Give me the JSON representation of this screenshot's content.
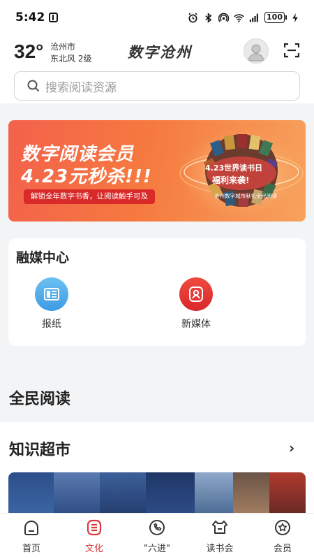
{
  "status_bar": {
    "time": "5:42",
    "battery": "100"
  },
  "header": {
    "temperature": "32°",
    "city": "沧州市",
    "wind": "东北风  2级",
    "app_title": "数字沧州",
    "search_placeholder": "搜索阅读资源"
  },
  "banner": {
    "title_line1": "数字阅读会员",
    "title_line2": "4.23元秒杀!!!",
    "tagline": "解锁全年数字书香，让阅读触手可及",
    "badge_line1": "4.23世界读书日",
    "badge_line2": "福利来袭!",
    "badge_line3": "沧州数字城市献礼全民阅读"
  },
  "rongmei": {
    "title": "融媒中心",
    "items": [
      {
        "label": "报纸"
      },
      {
        "label": "新媒体"
      }
    ]
  },
  "sections": {
    "quanmin": "全民阅读",
    "zhishi": "知识超市",
    "zhishi_more": "›"
  },
  "tabs": [
    {
      "label": "首页",
      "icon": "home-icon"
    },
    {
      "label": "文化",
      "icon": "culture-icon"
    },
    {
      "label": "\"六进\"",
      "icon": "phone-circle-icon"
    },
    {
      "label": "读书会",
      "icon": "book-club-icon"
    },
    {
      "label": "会员",
      "icon": "member-icon"
    }
  ],
  "colors": {
    "accent": "#d9383a",
    "banner_orange": "#f6793f",
    "newspaper_blue": "#4aa8e8",
    "newmedia_red": "#e5362f"
  }
}
